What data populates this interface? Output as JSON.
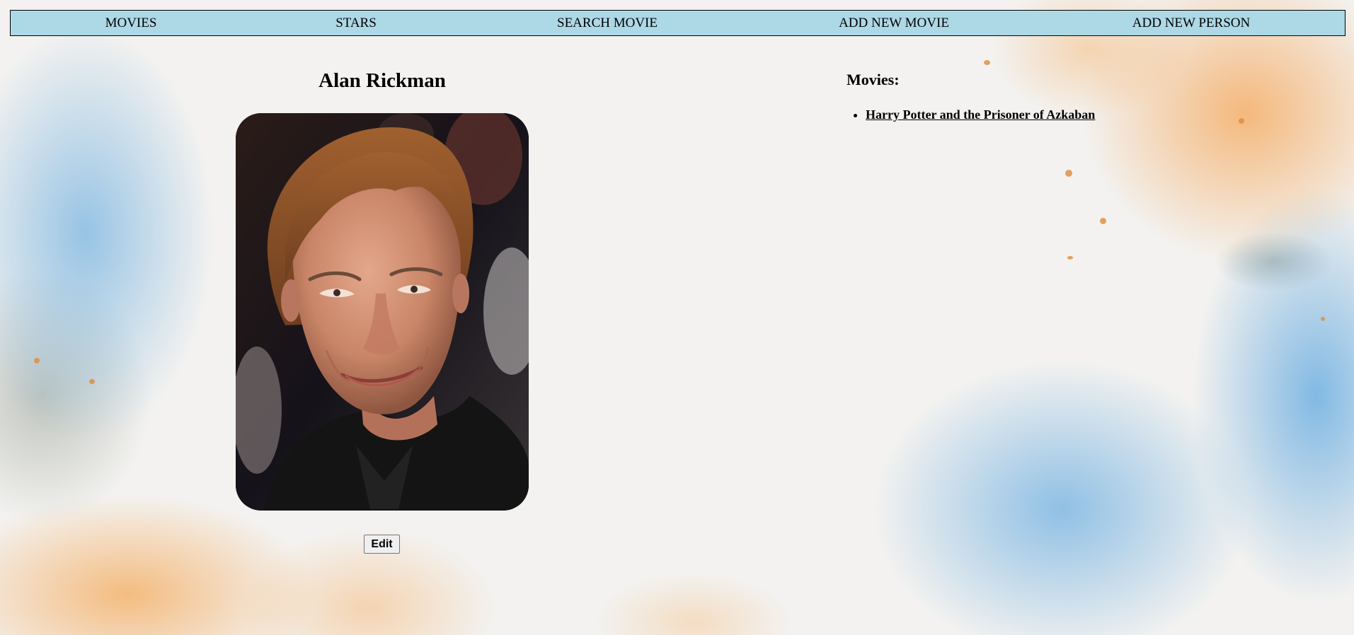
{
  "nav": {
    "items": [
      {
        "label": "MOVIES"
      },
      {
        "label": "STARS"
      },
      {
        "label": "SEARCH MOVIE"
      },
      {
        "label": "ADD NEW MOVIE"
      },
      {
        "label": "ADD NEW PERSON"
      }
    ],
    "background_color": "#add8e6"
  },
  "person": {
    "name": "Alan Rickman",
    "photo_icon": "person-photo",
    "edit_label": "Edit"
  },
  "movies": {
    "heading": "Movies:",
    "items": [
      {
        "title": "Harry Potter and the Prisoner of Azkaban"
      }
    ]
  }
}
